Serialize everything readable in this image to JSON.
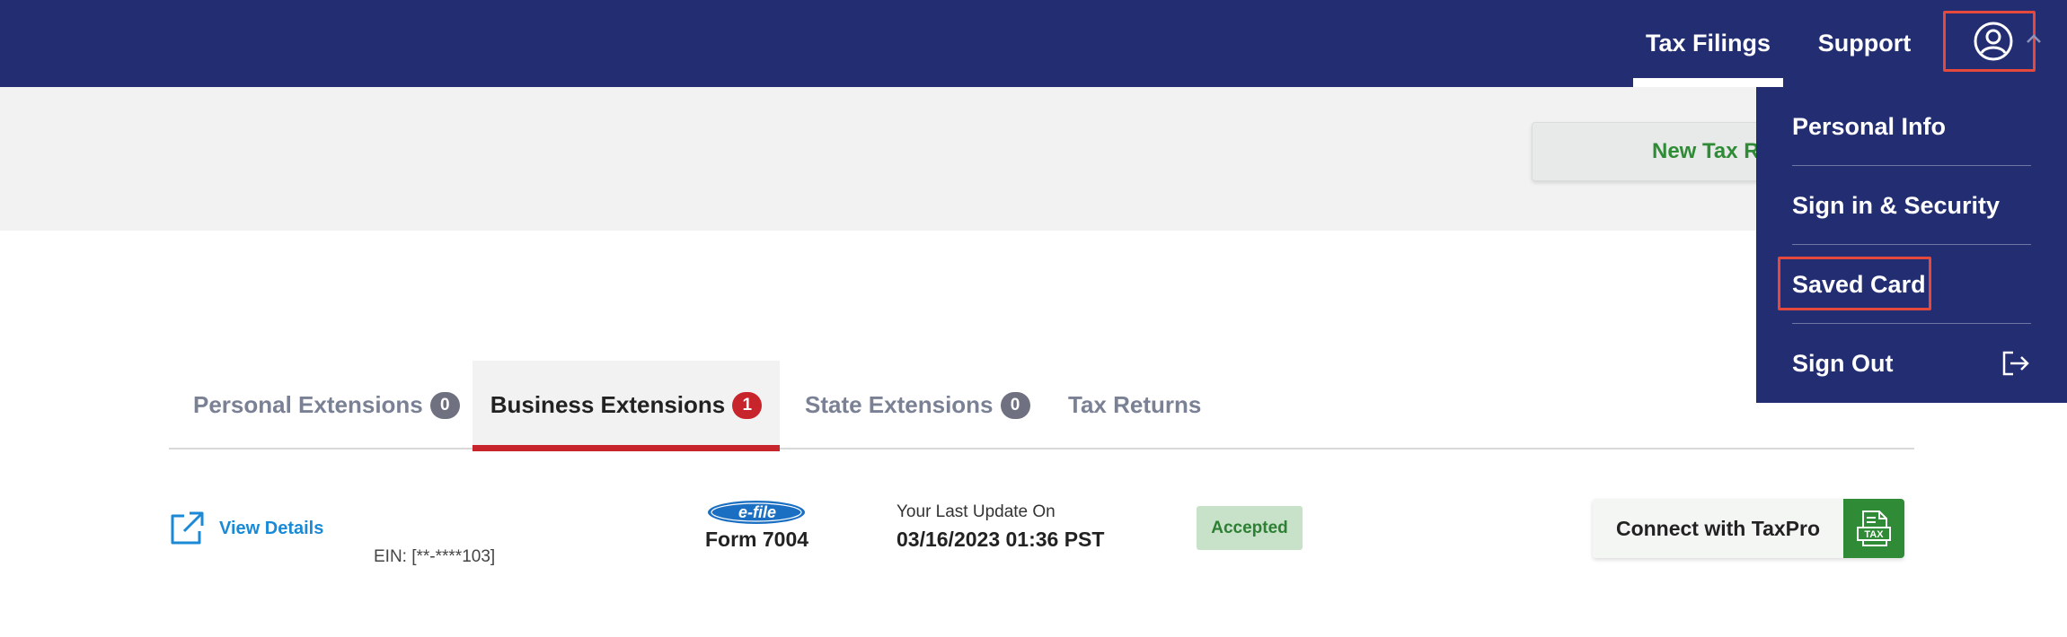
{
  "navbar": {
    "links": [
      {
        "label": "Tax Filings",
        "active": true
      },
      {
        "label": "Support",
        "active": false
      }
    ],
    "user_icon": "user-circle-icon",
    "caret_icon": "chevron-up-icon"
  },
  "toolbar": {
    "new_return_label": "New Tax Re"
  },
  "user_menu": {
    "items": [
      {
        "label": "Personal Info"
      },
      {
        "label": "Sign in & Security"
      },
      {
        "label": "Saved Card"
      },
      {
        "label": "Sign Out",
        "icon": "sign-out-icon"
      }
    ]
  },
  "tabs": [
    {
      "label": "Personal Extensions",
      "count": "0",
      "active": false
    },
    {
      "label": "Business Extensions",
      "count": "1",
      "active": true
    },
    {
      "label": "State Extensions",
      "count": "0",
      "active": false
    },
    {
      "label": "Tax Returns",
      "count": null,
      "active": false
    }
  ],
  "filing": {
    "view_details_label": "View Details",
    "ein": "EIN: [**-****103]",
    "efile_logo_text": "e-file",
    "form_name": "Form 7004",
    "update_label": "Your Last Update On",
    "update_value": "03/16/2023 01:36 PST",
    "status": "Accepted",
    "connect_label": "Connect with TaxPro",
    "connect_icon_text": "TAX"
  },
  "colors": {
    "navbar": "#222d72",
    "accent_red": "#c8242b",
    "accent_green": "#2f8b36",
    "link_blue": "#1a8ad6",
    "highlight_box": "#e4493c"
  }
}
